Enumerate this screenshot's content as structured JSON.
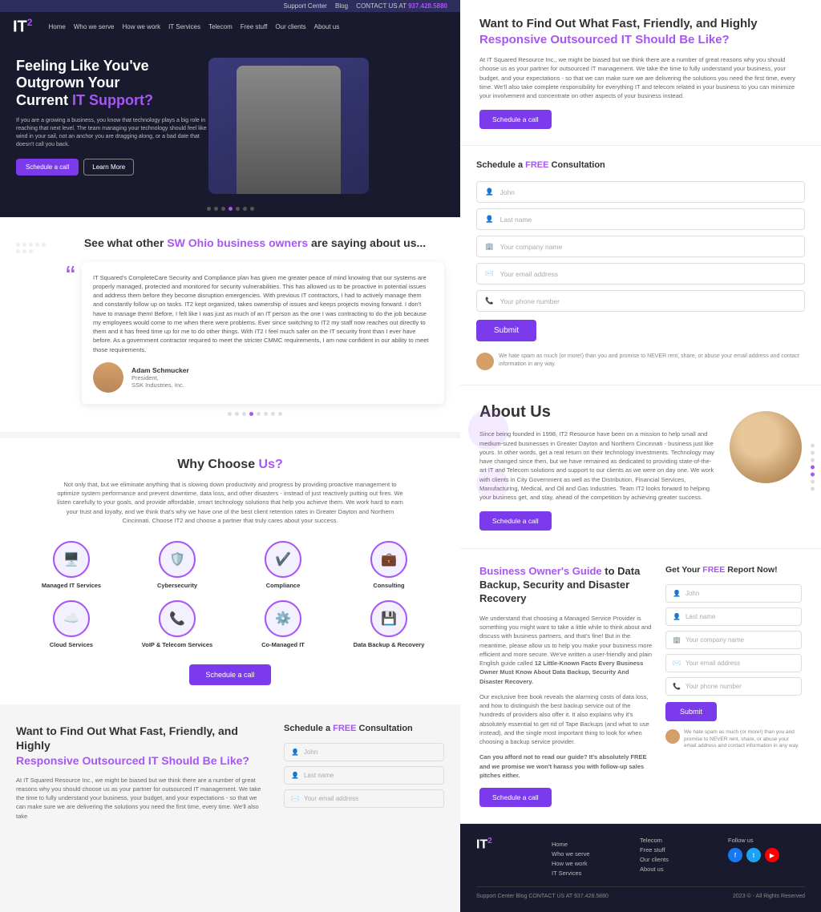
{
  "topbar": {
    "support": "Support Center",
    "blog": "Blog",
    "contact_label": "CONTACT US AT",
    "phone": "937.428.5880"
  },
  "nav": {
    "logo": "IT²",
    "links": [
      "Home",
      "Who we serve",
      "How we work",
      "IT Services",
      "Telecom",
      "Free stuff",
      "Our clients",
      "About us"
    ]
  },
  "hero": {
    "title_line1": "Feeling Like You've",
    "title_line2": "Outgrown Your",
    "title_line3": "Current",
    "title_highlight": "IT Support?",
    "description": "If you are a growing a business, you know that technology plays a big role in reaching that next level. The team managing your technology should feel like wind in your sail, not an anchor you are dragging along, or a bad date that doesn't call you back.",
    "btn_schedule": "Schedule a call",
    "btn_learn": "Learn More"
  },
  "testimonials": {
    "title_plain": "See what other",
    "title_highlight": "SW Ohio business owners",
    "title_end": "are saying about us...",
    "quote": "IT Squared's CompleteCare Security and Compliance plan has given me greater peace of mind knowing that our systems are properly managed, protected and monitored for security vulnerabilities. This has allowed us to be proactive in potential issues and address them before they become disruption emergencies.\n\nWith previous IT contractors, I had to actively manage them and constantly follow up on tasks. IT2 kept organized, takes ownership of issues and keeps projects moving forward. I don't have to manage them! Before, I felt like I was just as much of an IT person as the one I was contracting to do the job because my employees would come to me when there were problems. Ever since switching to IT2 my staff now reaches out directly to them and it has freed time up for me to do other things.\n\nWith IT2 I feel much safer on the IT security front than I ever have before. As a government contractor required to meet the stricter CMMC requirements, I am now confident in our ability to meet those requirements.",
    "author_name": "Adam Schmucker",
    "author_title1": "President,",
    "author_title2": "SSK Industries, Inc."
  },
  "hero_text_right": {
    "title_plain": "Want to Find Out What Fast, Friendly, and Highly",
    "title_highlight": "Responsive Outsourced IT Should Be Like?",
    "body": "At IT Squared Resource Inc., we might be biased but we think there are a number of great reasons why you should choose us as your partner for outsourced IT management. We take the time to fully understand your business, your budget, and your expectations - so that we can make sure we are delivering the solutions you need the first time, every time. We'll also take complete responsibility for everything IT and telecom related in your business to you can minimize your involvement and concentrate on other aspects of your business instead.",
    "btn_label": "Schedule a call"
  },
  "consultation": {
    "title_plain": "Schedule a",
    "title_highlight": "FREE",
    "title_end": "Consultation",
    "fields": [
      {
        "placeholder": "John",
        "icon": "person"
      },
      {
        "placeholder": "Last name",
        "icon": "person"
      },
      {
        "placeholder": "Your company name",
        "icon": "building"
      },
      {
        "placeholder": "Your email address",
        "icon": "email"
      },
      {
        "placeholder": "Your phone number",
        "icon": "phone"
      }
    ],
    "submit_label": "Submit",
    "privacy_text": "We hate spam as much (or more!) than you and promise to NEVER rent, share, or abuse your email address and contact information in any way."
  },
  "about": {
    "title": "About Us",
    "body": "Since being founded in 1998, IT2 Resource have been on a mission to help small and medium-sized businesses in Greater Dayton and Northern Cincinnati - business just like yours. In other words, get a real return on their technology investments. Technology may have changed since then, but we have remained as dedicated to providing state-of-the-art IT and Telecom solutions and support to our clients as we were on day one. We work with clients in City Government as well as the Distribution, Financial Services, Manufacturing, Medical, and Oil and Gas Industries.\n\nTeam IT2 looks forward to helping your business get, and stay, ahead of the competition by achieving greater success.",
    "btn_label": "Schedule a call"
  },
  "why": {
    "title_prefix": "Why Choose",
    "title_highlight": "Us?",
    "description": "Not only that, but we eliminate anything that is slowing down productivity and progress by providing proactive management to optimize system performance and prevent downtime, data loss, and other disasters - instead of just reactively putting out fires. We listen carefully to your goals, and provide affordable, smart technology solutions that help you achieve them. We work hard to earn your trust and loyalty, and we think that's why we have one of the best client retention rates in Greater Dayton and Northern Cincinnati. Choose IT2 and choose a partner that truly cares about your success.",
    "services": [
      {
        "name": "Managed IT Services",
        "icon": "🖥️"
      },
      {
        "name": "Cybersecurity",
        "icon": "🛡️"
      },
      {
        "name": "Compliance",
        "icon": "✓"
      },
      {
        "name": "Consulting",
        "icon": "💼"
      },
      {
        "name": "Cloud Services",
        "icon": "☁️"
      },
      {
        "name": "VoIP & Telecom Services",
        "icon": "📞"
      },
      {
        "name": "Co-Managed IT",
        "icon": "⚙️"
      },
      {
        "name": "Data Backup & Recovery",
        "icon": "💾"
      }
    ],
    "btn_label": "Schedule a call"
  },
  "guide": {
    "title_highlight": "Business Owner's Guide",
    "title_plain": "to Data Backup, Security and Disaster Recovery",
    "body1": "We understand that choosing a Managed Service Provider is something you might want to take a little while to think about and discuss with business partners, and that's fine! But in the meantime, please allow us to help you make your business more efficient and more secure. We've written a user-friendly and plain English guide called",
    "body_bold": "12 Little-Known Facts Every Business Owner Must Know About Data Backup, Security And Disaster Recovery.",
    "body2": "Our exclusive free book reveals the alarming costs of data loss, and how to distinguish the best backup service out of the hundreds of providers also offer it. It also explains why it's absolutely essential to get rid of Tape Backups (and what to use instead), and the single most important thing to look for when choosing a backup service provider.",
    "body_bottom": "Can you afford not to read our guide? It's absolutely FREE and we promise we won't harass you with follow-up sales pitches either.",
    "btn_label": "Schedule a call",
    "form_title_plain": "Get Your",
    "form_title_highlight": "FREE",
    "form_title_end": "Report Now!"
  },
  "footer": {
    "logo": "IT²",
    "links_col1": [
      "Home",
      "Who we serve",
      "How we work",
      "IT Services"
    ],
    "links_col2": [
      "Telecom",
      "Free stuff",
      "Our clients",
      "About us"
    ],
    "links_col3": [
      "Follow us"
    ],
    "bottom_left": "Support Center    Blog    CONTACT US AT 937.428.5880",
    "copyright": "2023 © - All Rights Reserved"
  },
  "bottom_repeat": {
    "title_plain": "Want to Find Out What Fast, Friendly, and Highly",
    "title_highlight": "Responsive Outsourced IT Should Be Like?",
    "body": "At IT Squared Resource Inc., we might be biased but we think there are a number of great reasons why you should choose us as your partner for outsourced IT management. We take the time to fully understand your business, your budget, and your expectations - so that we can make sure we are delivering the solutions you need the first time, every time. We'll also take",
    "consult_title_plain": "Schedule a",
    "consult_title_highlight": "FREE",
    "consult_title_end": "Consultation"
  }
}
